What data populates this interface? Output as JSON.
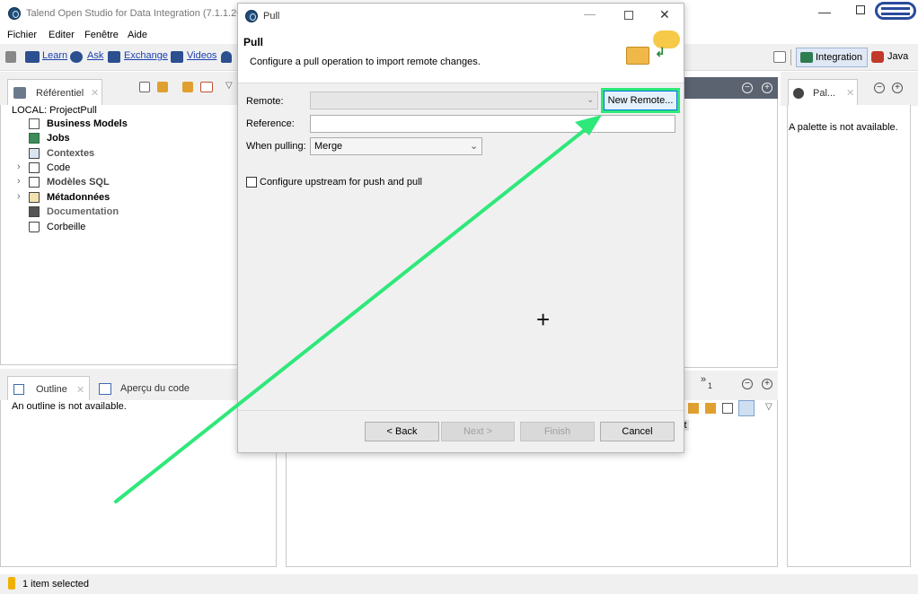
{
  "window": {
    "title": "Talend Open Studio for Data Integration (7.1.1.2018"
  },
  "menu": [
    "Fichier",
    "Editer",
    "Fenêtre",
    "Aide"
  ],
  "toolbar": {
    "learn": "Learn",
    "ask": "Ask",
    "exchange": "Exchange",
    "videos": "Videos"
  },
  "perspectives": {
    "integration": "Integration",
    "java": "Java"
  },
  "repo": {
    "tab": "Référentiel",
    "project": "LOCAL: ProjectPull",
    "items": [
      {
        "label": "Business Models",
        "icon": "business-models-icon"
      },
      {
        "label": "Jobs",
        "icon": "jobs-icon"
      },
      {
        "label": "Contextes",
        "icon": "contexts-icon"
      },
      {
        "label": "Code",
        "icon": "code-icon"
      },
      {
        "label": "Modèles SQL",
        "icon": "sql-templates-icon"
      },
      {
        "label": "Métadonnées",
        "icon": "metadata-icon"
      },
      {
        "label": "Documentation",
        "icon": "documentation-icon"
      },
      {
        "label": "Corbeille",
        "icon": "recycle-bin-icon"
      }
    ]
  },
  "outline": {
    "tab": "Outline",
    "tab2": "Aperçu du code",
    "empty": "An outline is not available."
  },
  "palette": {
    "tab": "Pal...",
    "empty": "A palette is not available."
  },
  "bottom_right": {
    "overflow": "»",
    "overflow_count": "1",
    "partial": "it"
  },
  "status": {
    "text": "1 item selected"
  },
  "dialog": {
    "title": "Pull",
    "heading": "Pull",
    "description": "Configure a pull operation to import remote changes.",
    "remote_label": "Remote:",
    "remote_value": "",
    "new_remote": "New Remote...",
    "reference_label": "Reference:",
    "reference_value": "",
    "when_pulling_label": "When pulling:",
    "when_pulling_value": "Merge",
    "upstream_checkbox": "Configure upstream for push and pull",
    "upstream_checked": false,
    "back": "< Back",
    "next": "Next >",
    "finish": "Finish",
    "cancel": "Cancel"
  },
  "colors": {
    "highlight": "#2ee87a",
    "link": "#1a3fb0"
  }
}
